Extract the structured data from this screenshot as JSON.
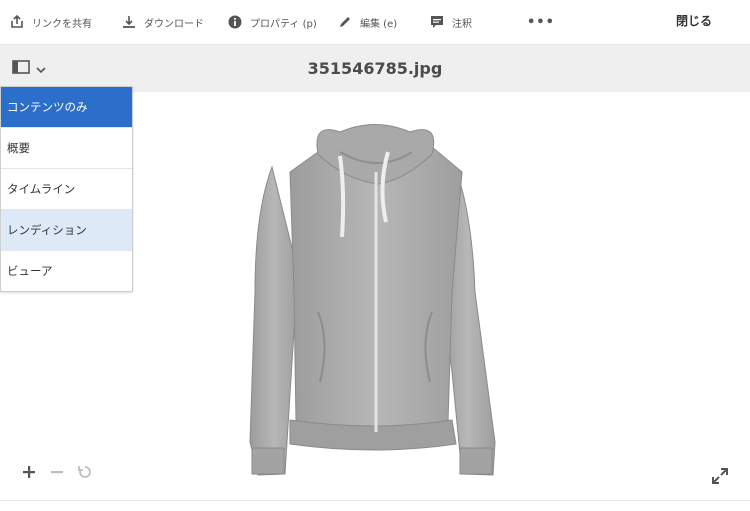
{
  "toolbar": {
    "share_label": "リンクを共有",
    "download_label": "ダウンロード",
    "properties_label": "プロパティ (p)",
    "edit_label": "編集 (e)",
    "annotate_label": "注釈",
    "more_label": "•••",
    "close_label": "閉じる"
  },
  "header": {
    "title": "351546785.jpg"
  },
  "rail_menu": {
    "items": [
      {
        "label": "コンテンツのみ",
        "state": "selected"
      },
      {
        "label": "概要",
        "state": "normal"
      },
      {
        "label": "タイムライン",
        "state": "normal"
      },
      {
        "label": "レンディション",
        "state": "hover"
      },
      {
        "label": "ビューア",
        "state": "normal"
      }
    ]
  },
  "viewer": {
    "asset": "gray-zip-hoodie-photo",
    "zoom_controls": [
      "zoom-in-icon",
      "zoom-out-icon",
      "reset-icon"
    ],
    "fullscreen_icon": "expand-icon"
  },
  "colors": {
    "accent": "#2c6fca",
    "hover": "#dde9f7",
    "titlebar": "#efefef",
    "text": "#4b4b4b"
  }
}
